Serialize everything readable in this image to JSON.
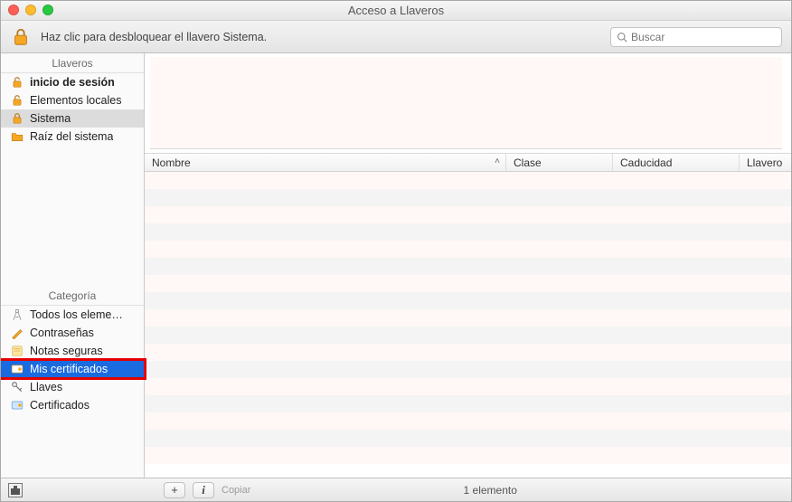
{
  "window_title": "Acceso a Llaveros",
  "toolbar": {
    "hint": "Haz clic para desbloquear el llavero Sistema.",
    "search_placeholder": "Buscar"
  },
  "sidebar": {
    "keychains_header": "Llaveros",
    "keychains": [
      {
        "label": "inicio de sesión",
        "icon": "unlock-icon",
        "bold": true
      },
      {
        "label": "Elementos locales",
        "icon": "unlock-icon"
      },
      {
        "label": "Sistema",
        "icon": "lock-icon",
        "selected_gray": true
      },
      {
        "label": "Raíz del sistema",
        "icon": "folder-icon"
      }
    ],
    "category_header": "Categoría",
    "categories": [
      {
        "label": "Todos los eleme…",
        "icon": "compass-icon"
      },
      {
        "label": "Contraseñas",
        "icon": "key-pencil-icon"
      },
      {
        "label": "Notas seguras",
        "icon": "note-icon"
      },
      {
        "label": "Mis certificados",
        "icon": "cert-icon",
        "selected_blue": true,
        "highlight": true
      },
      {
        "label": "Llaves",
        "icon": "key-icon"
      },
      {
        "label": "Certificados",
        "icon": "cert-icon"
      }
    ]
  },
  "table": {
    "columns": {
      "nombre": "Nombre",
      "clase": "Clase",
      "caducidad": "Caducidad",
      "llavero": "Llavero"
    },
    "sorted_column": "nombre",
    "row_count": 17
  },
  "footer": {
    "copy_label": "Copiar",
    "status": "1 elemento"
  },
  "colors": {
    "selection_blue": "#1a6be0",
    "highlight_red": "#e40000",
    "stripe_pink": "#fff8f6",
    "stripe_gray": "#f4f4f4"
  }
}
